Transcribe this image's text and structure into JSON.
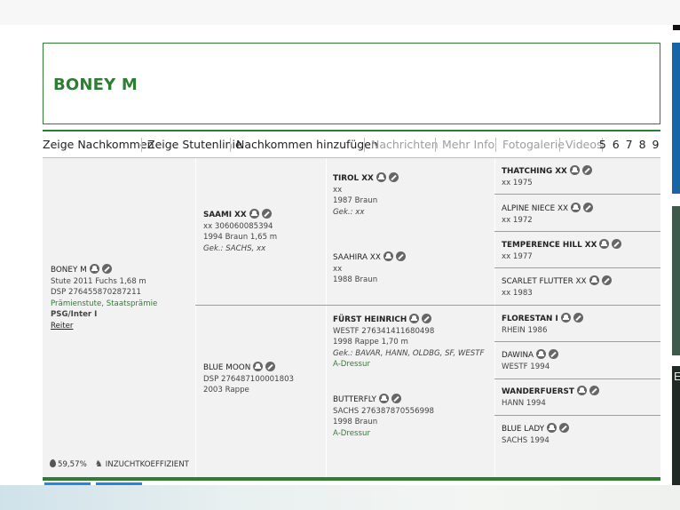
{
  "horse": {
    "title": "BONEY M"
  },
  "nav": {
    "items": [
      {
        "label": "Zeige Nachkommen"
      },
      {
        "label": "Zeige Stutenlinie"
      },
      {
        "label": "Nachkommen hinzufügen"
      },
      {
        "label": "Nachrichten"
      },
      {
        "label": "Mehr Info"
      },
      {
        "label": "Fotogalerie"
      },
      {
        "label": "Videos"
      }
    ],
    "pages": "5 6 7 8 9"
  },
  "pedigree": {
    "subject": {
      "name": "BONEY M",
      "line1": "Stute 2011 Fuchs 1,68 m",
      "line2": "DSP 276455870287211",
      "awards": "Prämienstute, Staatsprämie",
      "discipline": "PSG/Inter I",
      "link": "Reiter"
    },
    "sire": {
      "name": "SAAMI XX",
      "line1": "xx 306060085394",
      "line2": "1994 Braun 1,65 m",
      "line3": "Gek.: SACHS, xx"
    },
    "dam": {
      "name": "BLUE MOON",
      "line1": "DSP 276487100001803",
      "line2": "2003 Rappe"
    },
    "sire_sire": {
      "name": "TIROL XX",
      "line1": "xx",
      "line2": "1987 Braun",
      "line3": "Gek.: xx"
    },
    "sire_dam": {
      "name": "SAAHIRA XX",
      "line1": "xx",
      "line2": "1988 Braun"
    },
    "dam_sire": {
      "name": "FÜRST HEINRICH",
      "line1": "WESTF 276341411680498",
      "line2": "1998 Rappe 1,70 m",
      "line3": "Gek.: BAVAR, HANN, OLDBG, SF, WESTF",
      "line4": "A-Dressur"
    },
    "dam_dam": {
      "name": "BUTTERFLY",
      "line1": "SACHS 276387870556998",
      "line2": "1998 Braun",
      "line3": "A-Dressur"
    },
    "gen3": [
      {
        "name": "THATCHING XX",
        "info": "xx 1975"
      },
      {
        "name": "ALPINE NIECE XX",
        "info": "xx 1972"
      },
      {
        "name": "TEMPERENCE HILL XX",
        "info": "xx 1977"
      },
      {
        "name": "SCARLET FLUTTER XX",
        "info": "xx 1983"
      },
      {
        "name": "FLORESTAN I",
        "info": "RHEIN 1986"
      },
      {
        "name": "DAWINA",
        "info": "WESTF 1994"
      },
      {
        "name": "WANDERFUERST",
        "info": "HANN 1994"
      },
      {
        "name": "BLUE LADY",
        "info": "SACHS 1994"
      }
    ]
  },
  "stats": {
    "percent": "59,57%",
    "inbreeding_label": "INZUCHTKOEFFIZIENT"
  },
  "side": {
    "letter": "E"
  },
  "icons": {
    "family": "family-tree-icon",
    "edit": "pencil-icon",
    "drop": "drop-icon",
    "horse": "horse-icon"
  },
  "colors": {
    "accent": "#2e7d32",
    "muted": "#9e9e9e",
    "panel": "#f2f2f2"
  }
}
